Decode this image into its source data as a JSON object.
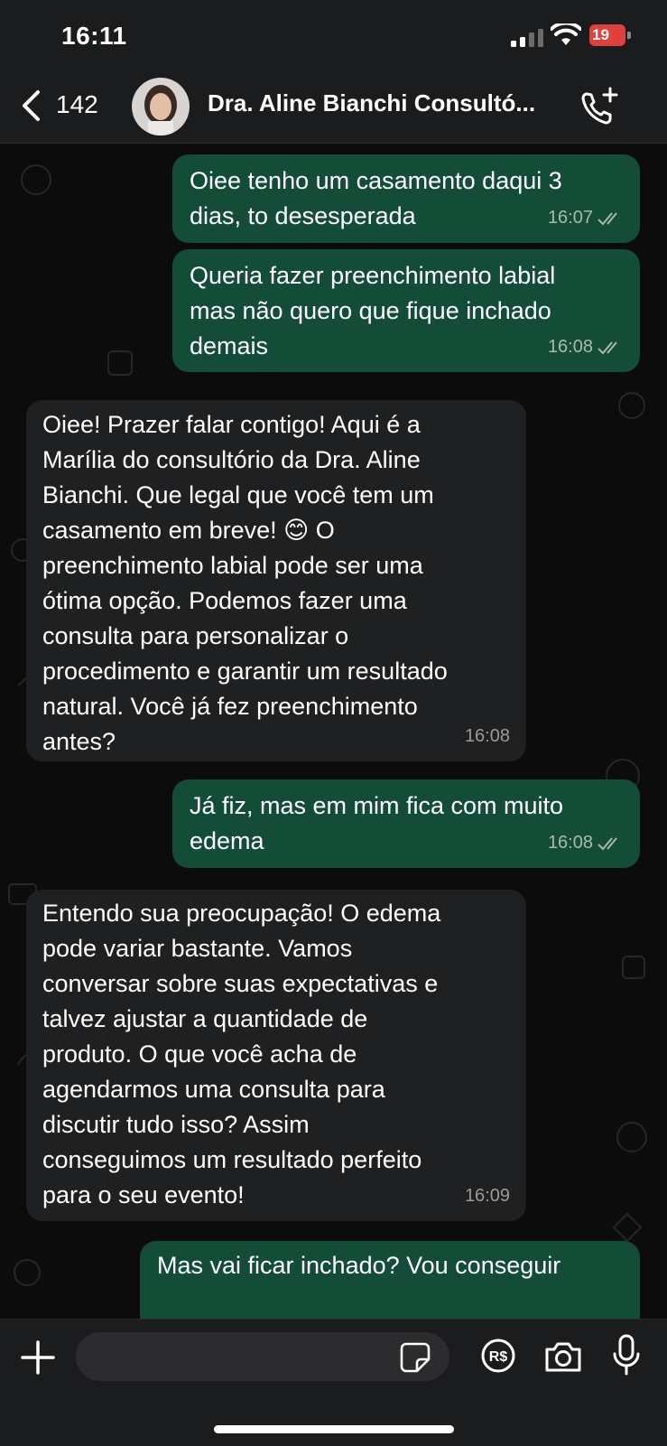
{
  "status_bar": {
    "time": "16:11",
    "battery": "19"
  },
  "header": {
    "back_count": "142",
    "contact_name": "Dra. Aline Bianchi Consultó..."
  },
  "messages": [
    {
      "direction": "out",
      "text": "Oiee tenho um casamento daqui 3\ndias, to desesperada",
      "time": "16:07"
    },
    {
      "direction": "out",
      "text": "Queria fazer preenchimento labial\nmas não quero que fique inchado\ndemais",
      "time": "16:08"
    },
    {
      "direction": "in",
      "text": "Oiee! Prazer falar contigo! Aqui é a\nMarília do consultório da Dra. Aline\nBianchi. Que legal que você tem um\ncasamento em breve! 😊 O\npreenchimento labial pode ser uma\nótima opção. Podemos fazer uma\nconsulta para personalizar o\nprocedimento e garantir um resultado\nnatural. Você já fez preenchimento\nantes?",
      "time": "16:08"
    },
    {
      "direction": "out",
      "text": "Já fiz, mas em mim fica com muito\nedema",
      "time": "16:08"
    },
    {
      "direction": "in",
      "text": "Entendo sua preocupação! O edema\npode variar bastante. Vamos\nconversar sobre suas expectativas e\ntalvez ajustar a quantidade de\nproduto. O que você acha de\nagendarmos uma consulta para\ndiscutir tudo isso? Assim\nconseguimos um resultado perfeito\npara o seu evento!",
      "time": "16:09"
    },
    {
      "direction": "out",
      "text": "Mas vai ficar inchado? Vou conseguir",
      "time": ""
    }
  ],
  "input_bar": {
    "placeholder": ""
  },
  "colors": {
    "outgoing_bubble": "#144d37",
    "incoming_bubble": "#1f2022",
    "bar_background": "#1b1c1d",
    "battery_low": "#e0413a"
  }
}
